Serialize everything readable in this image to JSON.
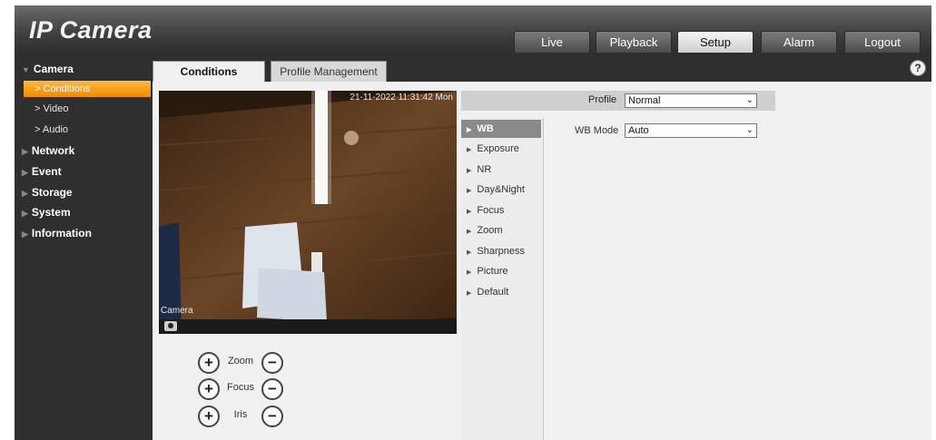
{
  "app": {
    "title": "IP Camera"
  },
  "nav": {
    "tabs": [
      {
        "label": "Live"
      },
      {
        "label": "Playback"
      },
      {
        "label": "Setup",
        "active": true
      },
      {
        "label": "Alarm"
      },
      {
        "label": "Logout"
      }
    ]
  },
  "sidebar": {
    "camera": "Camera",
    "subs": [
      "Conditions",
      "Video",
      "Audio"
    ],
    "items": [
      "Network",
      "Event",
      "Storage",
      "System",
      "Information"
    ]
  },
  "subtabs": {
    "conditions": "Conditions",
    "profile_management": "Profile Management"
  },
  "video": {
    "timestamp": "21-11-2022 11:31:42 Mon",
    "label": "Camera"
  },
  "controls": {
    "zoom": "Zoom",
    "focus": "Focus",
    "iris": "Iris",
    "plus": "+",
    "minus": "−"
  },
  "settings": {
    "profile_label": "Profile",
    "profile_value": "Normal",
    "menu": [
      "WB",
      "Exposure",
      "NR",
      "Day&Night",
      "Focus",
      "Zoom",
      "Sharpness",
      "Picture",
      "Default"
    ],
    "wb_mode_label": "WB Mode",
    "wb_mode_value": "Auto"
  },
  "icons": {
    "help": "?",
    "caret": "⌄",
    "tri": "▶"
  },
  "colors": {
    "accent": "#f18a00",
    "header": "#3e3e3e"
  }
}
